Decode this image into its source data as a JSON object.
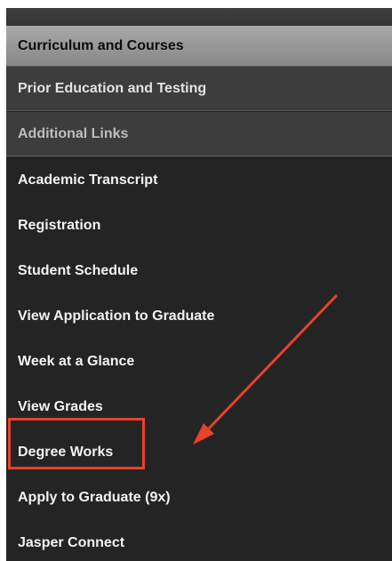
{
  "sections": [
    {
      "label": "Curriculum and Courses"
    },
    {
      "label": "Prior Education and Testing"
    },
    {
      "label": "Additional Links"
    }
  ],
  "links": [
    {
      "label": "Academic Transcript"
    },
    {
      "label": "Registration"
    },
    {
      "label": "Student Schedule"
    },
    {
      "label": "View Application to Graduate"
    },
    {
      "label": "Week at a Glance"
    },
    {
      "label": "View Grades"
    },
    {
      "label": "Degree Works"
    },
    {
      "label": "Apply to Graduate (9x)"
    },
    {
      "label": "Jasper Connect"
    }
  ],
  "annotation": {
    "highlight_target": "Degree Works",
    "color": "#e8412c"
  },
  "colors": {
    "panel_background": "#242424",
    "active_header": "#9a9a9a",
    "section_header": "#3d3d3d",
    "link_text": "#f2f2f2"
  }
}
